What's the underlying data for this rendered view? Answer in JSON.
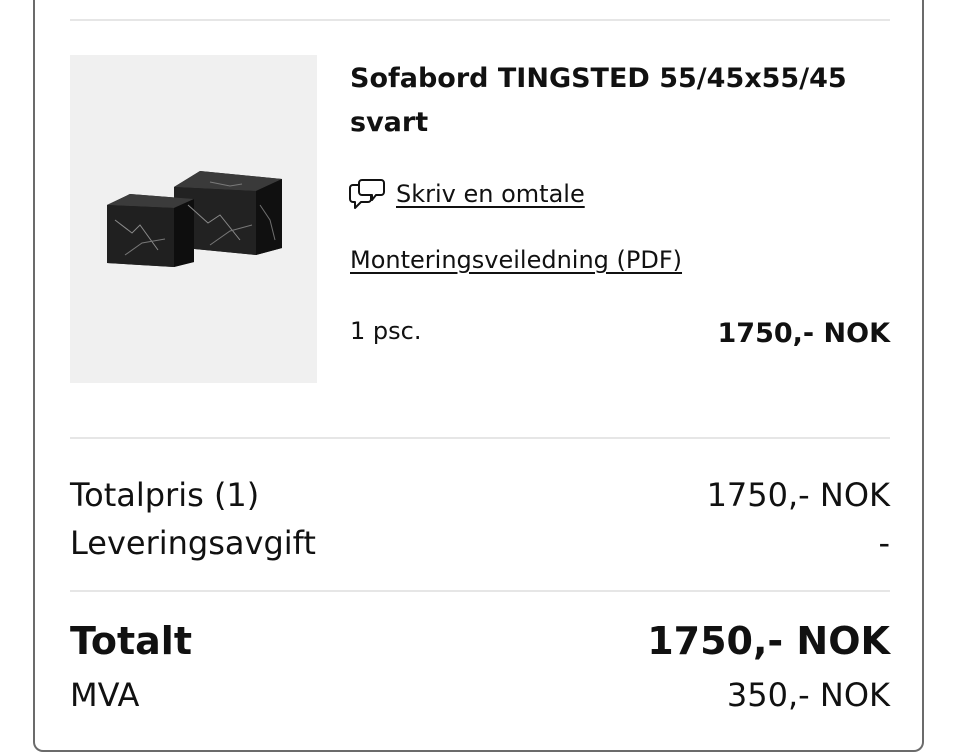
{
  "product": {
    "image_alt": "Two black marble-look cube coffee tables",
    "title": "Sofabord TINGSTED 55/45x55/45 svart",
    "review_link": "Skriv en omtale",
    "assembly_link": "Monteringsveiledning (PDF)",
    "quantity": "1 psc.",
    "price": "1750,- NOK"
  },
  "summary": {
    "totalpris_label": "Totalpris (1)",
    "totalpris_value": "1750,- NOK",
    "delivery_label": "Leveringsavgift",
    "delivery_value": "-",
    "total_label": "Totalt",
    "total_value": "1750,- NOK",
    "vat_label": "MVA",
    "vat_value": "350,- NOK"
  },
  "icons": {
    "review": "speech-bubbles-icon"
  },
  "colors": {
    "text": "#111111",
    "divider": "#e6e6e6",
    "image_bg": "#f0f0f0",
    "card_border": "#6b6b6b"
  }
}
